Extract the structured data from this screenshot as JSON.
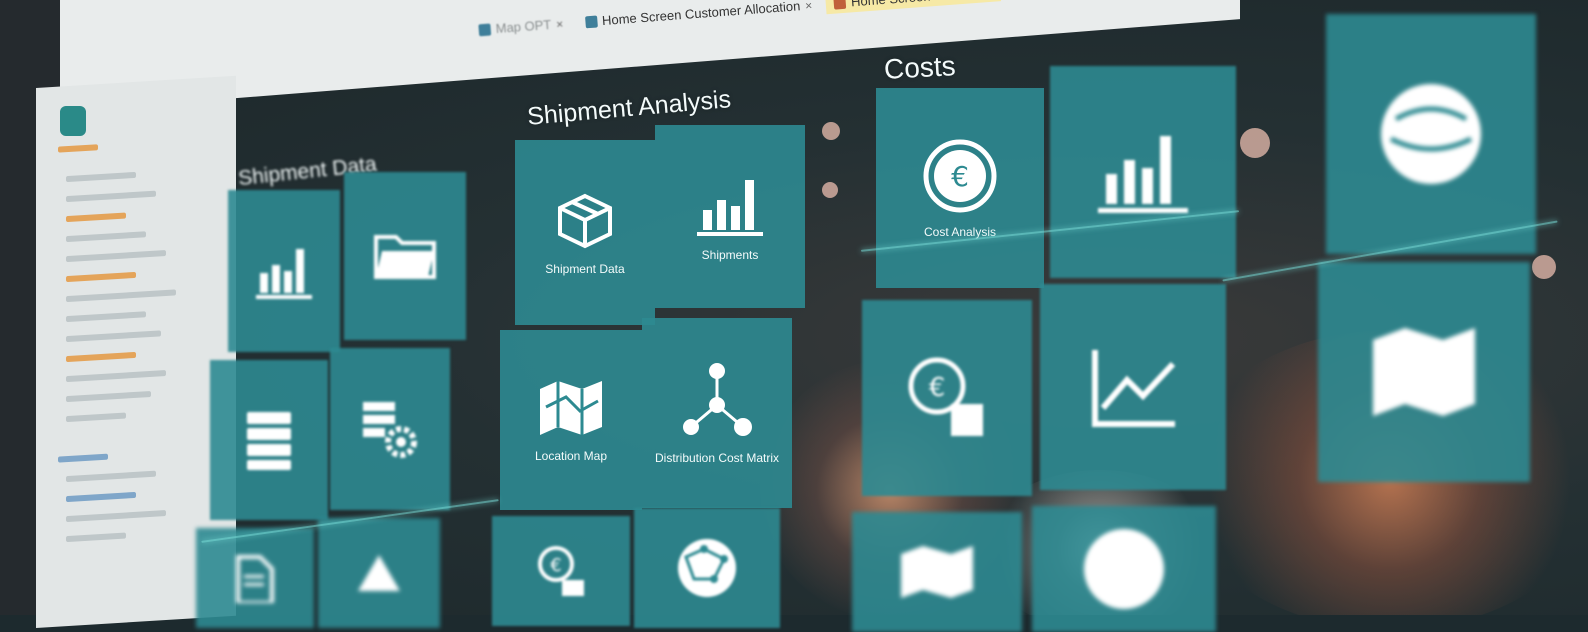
{
  "browser": {
    "tabs": [
      {
        "label": "Map OPT"
      },
      {
        "label": "Home Screen Customer Allocation"
      },
      {
        "label": "Home Screen Visibility"
      }
    ]
  },
  "sections": {
    "shipment_data": "Shipment Data",
    "shipment_analysis": "Shipment Analysis",
    "costs": "Costs"
  },
  "tiles": {
    "shipment_data": "Shipment Data",
    "shipments": "Shipments",
    "location_map": "Location Map",
    "distribution_cost_matrix": "Distribution Cost Matrix",
    "cost_analysis": "Cost Analysis"
  },
  "colors": {
    "tile": "#2d8a91",
    "tab_active": "#f6e9a6"
  }
}
